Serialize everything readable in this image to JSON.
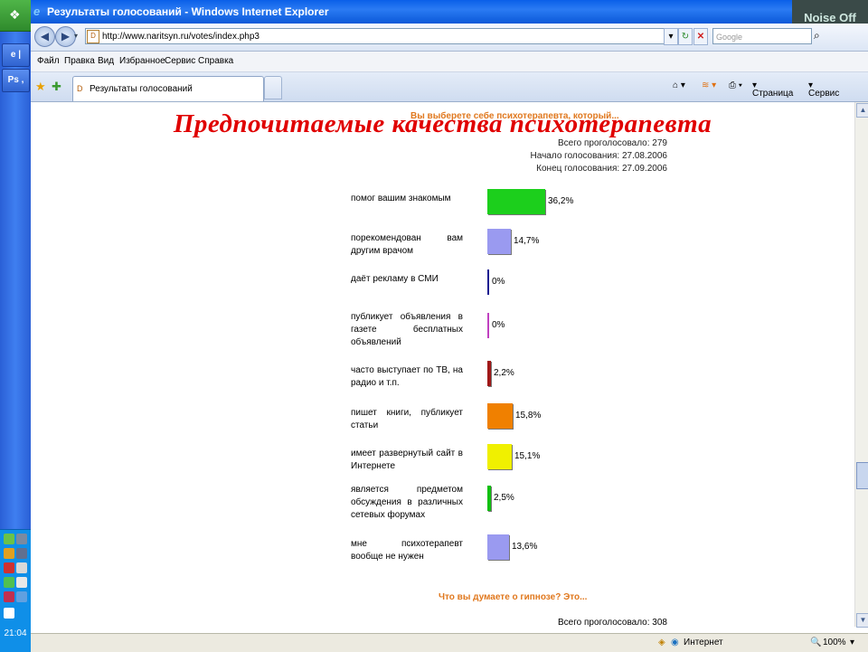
{
  "taskbar": {
    "buttons": [
      "e |",
      "Ps ,"
    ],
    "clock": "21:04"
  },
  "window": {
    "title": "Результаты голосований - Windows Internet Explorer",
    "watermark": "Noise Off"
  },
  "address": {
    "url": "http://www.naritsyn.ru/votes/index.php3",
    "search_placeholder": "Google"
  },
  "menu": [
    "Файл",
    "Правка",
    "Вид",
    "Избранное",
    "Сервис",
    "Справка"
  ],
  "tab": {
    "label": "Результаты голосований"
  },
  "commands": {
    "page": "Страница",
    "tools": "Сервис"
  },
  "page": {
    "slide_title": "Предпочитаемые качества психотерапевта",
    "question": "Вы выберете себе психотерапевта, который...",
    "total": "Всего проголосовало: 279",
    "start": "Начало голосования: 27.08.2006",
    "end": "Конец голосования: 27.09.2006",
    "question2": "Что вы думаете о гипнозе? Это...",
    "total2": "Всего проголосовало: 308"
  },
  "chart_data": {
    "type": "bar",
    "orientation": "horizontal",
    "categories": [
      "помог вашим знакомым",
      "порекомендован вам другим врачом",
      "даёт рекламу в СМИ",
      "публикует объявления в газете бесплатных объявлений",
      "часто выступает по ТВ, на радио и т.п.",
      "пишет книги, публикует статьи",
      "имеет развернутый сайт в Интернете",
      "является предметом обсуждения в различных сетевых форумах",
      "мне психотерапевт вообще не нужен"
    ],
    "values": [
      36.2,
      14.7,
      0,
      0,
      2.2,
      15.8,
      15.1,
      2.5,
      13.6
    ],
    "labels": [
      "36,2%",
      "14,7%",
      "0%",
      "0%",
      "2,2%",
      "15,8%",
      "15,1%",
      "2,5%",
      "13,6%"
    ],
    "colors": [
      "#1ccf1c",
      "#9a9af0",
      "#1a1a90",
      "#c040c0",
      "#a01818",
      "#f08000",
      "#f0f000",
      "#10c010",
      "#9a9af0"
    ]
  },
  "status": {
    "zone": "Интернет",
    "zoom": "100%"
  }
}
